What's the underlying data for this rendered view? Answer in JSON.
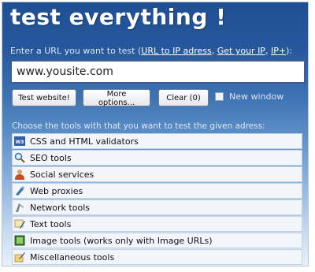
{
  "header": {
    "logo_text": "test everything !"
  },
  "url_prompt": {
    "text": "Enter a URL you want to test (",
    "link_ip": "URL to IP adress",
    "sep1": ", ",
    "link_get_ip": "Get your IP",
    "sep2": ", ",
    "link_ip_plus": "IP+",
    "text_end": "):"
  },
  "url_input": {
    "value": "www.yousite.com"
  },
  "buttons": {
    "test_label": "Test website!",
    "more_label": "More options...",
    "clear_label": "Clear (0)"
  },
  "new_window": {
    "label": "New window",
    "checked": false
  },
  "tools": {
    "heading": "Choose the tools with that you want to test the given adress:",
    "items": [
      {
        "label": "CSS and HTML validators",
        "icon": "validator-icon"
      },
      {
        "label": "SEO tools",
        "icon": "magnifier-icon"
      },
      {
        "label": "Social services",
        "icon": "user-icon"
      },
      {
        "label": "Web proxies",
        "icon": "proxy-icon"
      },
      {
        "label": "Network tools",
        "icon": "network-icon"
      },
      {
        "label": "Text tools",
        "icon": "text-icon"
      },
      {
        "label": "Image tools (works only with Image URLs)",
        "icon": "image-icon"
      },
      {
        "label": "Miscellaneous tools",
        "icon": "misc-icon"
      }
    ]
  }
}
